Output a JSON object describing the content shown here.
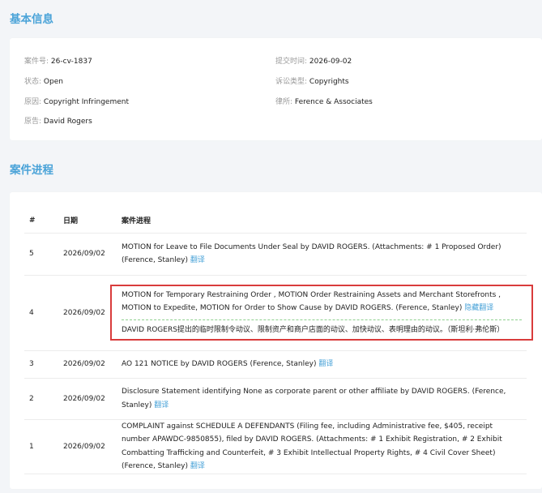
{
  "basic": {
    "title": "基本信息",
    "case_no": {
      "label": "案件号:",
      "value": "26-cv-1837"
    },
    "submit_time": {
      "label": "提交时间:",
      "value": "2026-09-02"
    },
    "status": {
      "label": "状态:",
      "value": "Open"
    },
    "lawsuit_type": {
      "label": "诉讼类型:",
      "value": "Copyrights"
    },
    "cause": {
      "label": "原因:",
      "value": "Copyright Infringement"
    },
    "law_firm": {
      "label": "律所:",
      "value": "Ference & Associates"
    },
    "plaintiff": {
      "label": "原告:",
      "value": "David Rogers"
    }
  },
  "progress": {
    "title": "案件进程",
    "headers": {
      "num": "#",
      "date": "日期",
      "progress": "案件进程"
    },
    "translate_label": "翻译",
    "hide_translate_label": "隐藏翻译",
    "rows": [
      {
        "num": "5",
        "date": "2026/09/02",
        "text": "MOTION for Leave to File Documents Under Seal by DAVID ROGERS. (Attachments: # 1 Proposed Order) (Ference, Stanley)"
      },
      {
        "num": "4",
        "date": "2026/09/02",
        "text": "MOTION for Temporary Restraining Order , MOTION Order Restraining Assets and Merchant Storefronts , MOTION to Expedite, MOTION for Order to Show Cause by DAVID ROGERS. (Ference, Stanley)",
        "translation": "DAVID ROGERS提出的临时限制令动议、限制资产和商户店面的动议、加快动议、表明理由的动议。（斯坦利·弗伦斯）"
      },
      {
        "num": "3",
        "date": "2026/09/02",
        "text": "AO 121 NOTICE by DAVID ROGERS (Ference, Stanley)"
      },
      {
        "num": "2",
        "date": "2026/09/02",
        "text": "Disclosure Statement identifying None as corporate parent or other affiliate by DAVID ROGERS. (Ference, Stanley)"
      },
      {
        "num": "1",
        "date": "2026/09/02",
        "text": "COMPLAINT against SCHEDULE A DEFENDANTS (Filing fee, including Administrative fee, $405, receipt number APAWDC-9850855), filed by DAVID ROGERS. (Attachments: # 1 Exhibit Registration, # 2 Exhibit Combatting Trafficking and Counterfeit, # 3 Exhibit Intellectual Property Rights, # 4 Civil Cover Sheet) (Ference, Stanley)"
      }
    ]
  },
  "colors": {
    "accent": "#4aa3d8",
    "highlight_border": "#d93c3c",
    "separator": "#8fd08f"
  }
}
